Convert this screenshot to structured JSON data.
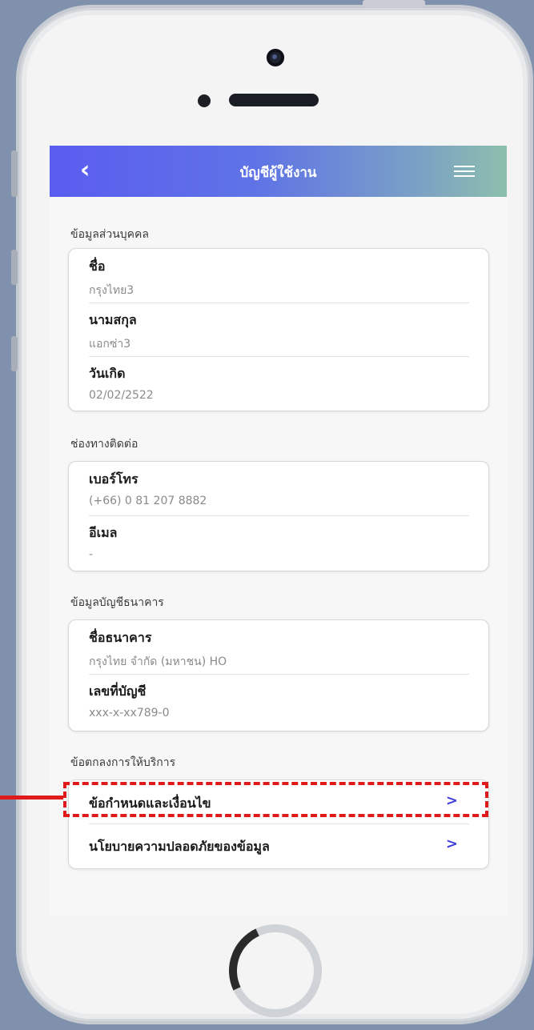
{
  "header": {
    "title": "บัญชีผู้ใช้งาน",
    "back_icon": "chevron-left-icon",
    "menu_icon": "hamburger-menu-icon"
  },
  "personal": {
    "section_label": "ข้อมูลส่วนบุคคล",
    "first_name_label": "ชื่อ",
    "first_name_value": "กรุงไทย3",
    "last_name_label": "นามสกุล",
    "last_name_value": "แอกซ่า3",
    "birthdate_label": "วันเกิด",
    "birthdate_value": "02/02/2522"
  },
  "contact": {
    "section_label": "ช่องทางติดต่อ",
    "phone_label": "เบอร์โทร",
    "phone_value": "(+66) 0 81 207 8882",
    "email_label": "อีเมล",
    "email_value": "-"
  },
  "bank": {
    "section_label": "ข้อมูลบัญชีธนาคาร",
    "bank_name_label": "ชื่อธนาคาร",
    "bank_name_value": "กรุงไทย จำกัด (มหาชน) HO",
    "account_label": "เลขที่บัญชี",
    "account_value": "xxx-x-xx789-0"
  },
  "terms": {
    "section_label": "ข้อตกลงการให้บริการ",
    "items": [
      {
        "label": "ข้อกำหนดและเงื่อนไข",
        "chevron": ">"
      },
      {
        "label": "นโยบายความปลอดภัยของข้อมูล",
        "chevron": ">"
      }
    ]
  },
  "colors": {
    "header_gradient_start": "#5a5cf0",
    "header_gradient_end": "#8dbfac",
    "chevron": "#4040d8",
    "highlight": "#e01a1a"
  }
}
